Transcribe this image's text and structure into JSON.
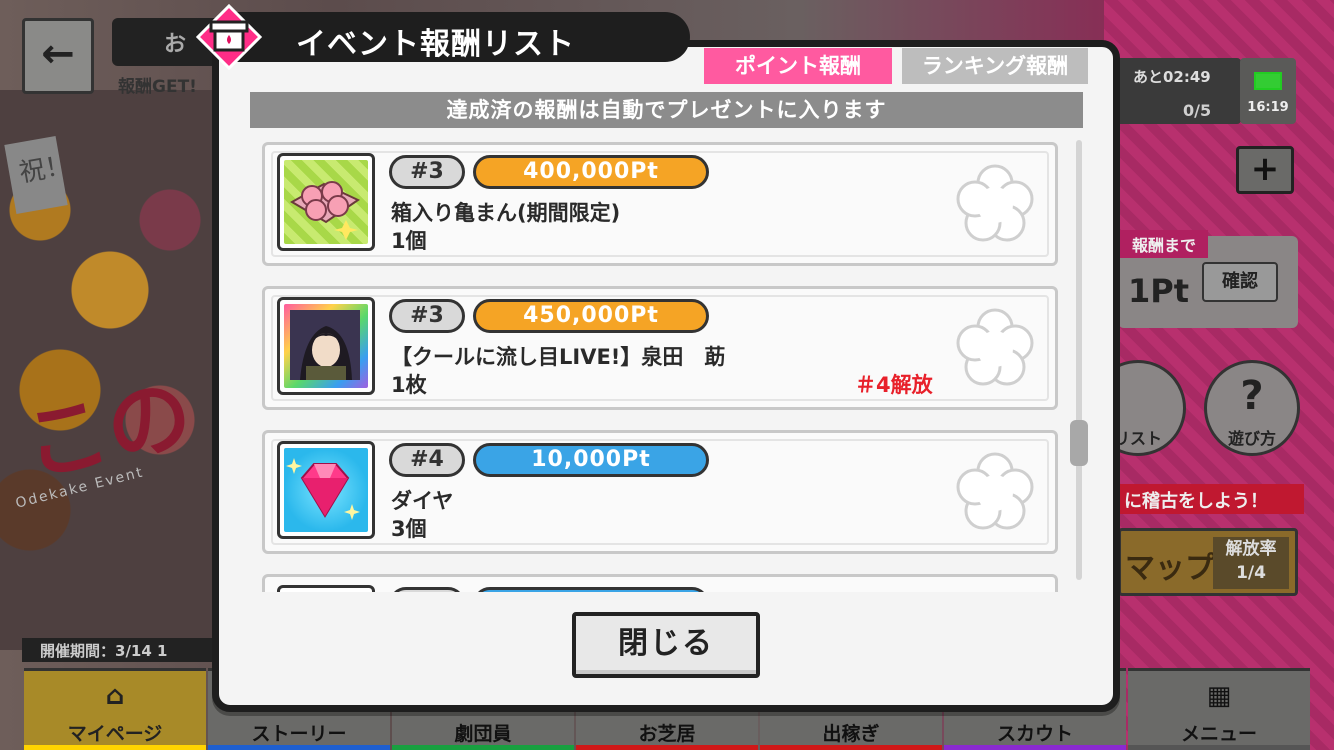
{
  "background": {
    "back_label": "←",
    "top_label": "お",
    "get_label": "報酬GET!",
    "iwai": "祝！",
    "event_title": "この",
    "odekake": "Odekake Event",
    "period": "開催期間：3/14 1",
    "timer": "あと02:49",
    "counter": "0/5",
    "clock": "16:19",
    "plus": "+",
    "until_label": "報酬まで",
    "pt_text": "1Pt",
    "confirm_label": "確認",
    "list_label": "リスト",
    "howto_label": "遊び方",
    "promo_text": "に稽古をしよう！",
    "map_label": "マップ",
    "rate_label": "解放率",
    "rate_value": "1/4",
    "nav": [
      {
        "label": "マイページ",
        "color": "#ffd400"
      },
      {
        "label": "ストーリー",
        "color": "#1e5fd0"
      },
      {
        "label": "劇団員",
        "color": "#18a040"
      },
      {
        "label": "お芝居",
        "color": "#d01818"
      },
      {
        "label": "出稼ぎ",
        "color": "#d01818"
      },
      {
        "label": "スカウト",
        "color": "#8a2ad0"
      },
      {
        "label": "メニュー",
        "color": "#555555"
      }
    ]
  },
  "dialog": {
    "title": "イベント報酬リスト",
    "tabs": {
      "point": "ポイント報酬",
      "ranking": "ランキング報酬"
    },
    "notice": "達成済の報酬は自動でプレゼントに入ります",
    "close_label": "閉じる"
  },
  "rewards": [
    {
      "rank": "#3",
      "points": "400,000Pt",
      "name": "箱入り亀まん(期間限定)",
      "qty": "1個",
      "unlock": "",
      "pill_color": "orange"
    },
    {
      "rank": "#3",
      "points": "450,000Pt",
      "name": "【クールに流し目LIVE!】泉田　莇",
      "qty": "1枚",
      "unlock": "＃4解放",
      "pill_color": "orange"
    },
    {
      "rank": "#4",
      "points": "10,000Pt",
      "name": "ダイヤ",
      "qty": "3個",
      "unlock": "",
      "pill_color": "blue"
    }
  ]
}
